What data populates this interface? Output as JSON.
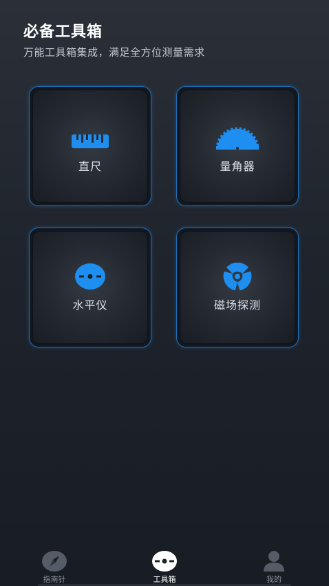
{
  "header": {
    "title": "必备工具箱",
    "subtitle": "万能工具箱集成，满足全方位测量需求"
  },
  "tools": [
    {
      "label": "直尺",
      "icon": "ruler-icon"
    },
    {
      "label": "量角器",
      "icon": "protractor-icon"
    },
    {
      "label": "水平仪",
      "icon": "level-icon"
    },
    {
      "label": "磁场探测",
      "icon": "magnetic-field-icon"
    }
  ],
  "tabbar": {
    "items": [
      {
        "label": "指南针",
        "icon": "compass-icon",
        "active": false
      },
      {
        "label": "工具箱",
        "icon": "toolbox-icon",
        "active": true
      },
      {
        "label": "我的",
        "icon": "profile-icon",
        "active": false
      }
    ]
  },
  "colors": {
    "accent": "#1e8ff0",
    "card_border": "#1d6fb7",
    "inactive_tab": "#8d939b"
  }
}
